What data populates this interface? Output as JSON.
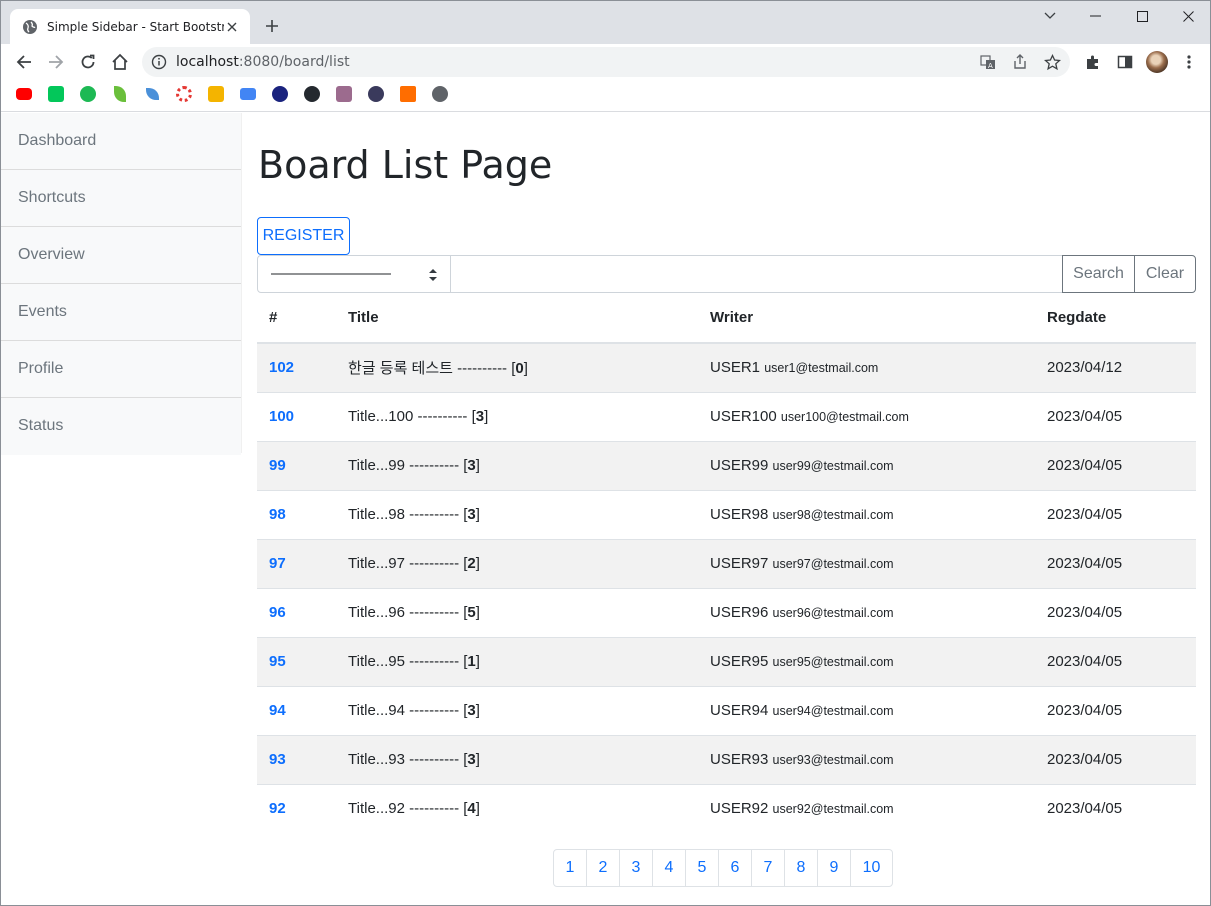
{
  "browser": {
    "tab_title": "Simple Sidebar - Start Bootstrap",
    "url_host": "localhost",
    "url_path": ":8080/board/list",
    "icons": [
      "globe-icon",
      "close-icon",
      "plus-icon",
      "minimize-icon",
      "maximize-icon",
      "window-close-icon",
      "back-icon",
      "forward-icon",
      "reload-icon",
      "home-icon",
      "info-icon",
      "translate-icon",
      "share-icon",
      "star-icon",
      "extensions-icon",
      "sidepanel-icon",
      "menu-icon"
    ],
    "bookmark_colors": [
      "#ff0000",
      "#03c75a",
      "#1db954",
      "#6abf3b",
      "#4a90d9",
      "#e53935",
      "#f4b400",
      "#4285f4",
      "#1a237e",
      "#24292f",
      "#9c6b8e",
      "#3a3a5c",
      "#ff6d00",
      "#5f6368"
    ]
  },
  "sidebar": {
    "items": [
      {
        "label": "Dashboard"
      },
      {
        "label": "Shortcuts"
      },
      {
        "label": "Overview"
      },
      {
        "label": "Events"
      },
      {
        "label": "Profile"
      },
      {
        "label": "Status"
      }
    ]
  },
  "main": {
    "title": "Board List Page",
    "register_label": "REGISTER",
    "search": {
      "select_value": "————————",
      "input_value": "",
      "search_label": "Search",
      "clear_label": "Clear"
    },
    "table": {
      "headers": [
        "#",
        "Title",
        "Writer",
        "Regdate"
      ],
      "rows": [
        {
          "bno": "102",
          "title": "한글 등록 테스트 ---------- [",
          "count": "0",
          "writer": "USER1",
          "email": "user1@testmail.com",
          "regdate": "2023/04/12"
        },
        {
          "bno": "100",
          "title": "Title...100 ---------- [",
          "count": "3",
          "writer": "USER100",
          "email": "user100@testmail.com",
          "regdate": "2023/04/05"
        },
        {
          "bno": "99",
          "title": "Title...99 ---------- [",
          "count": "3",
          "writer": "USER99",
          "email": "user99@testmail.com",
          "regdate": "2023/04/05"
        },
        {
          "bno": "98",
          "title": "Title...98 ---------- [",
          "count": "3",
          "writer": "USER98",
          "email": "user98@testmail.com",
          "regdate": "2023/04/05"
        },
        {
          "bno": "97",
          "title": "Title...97 ---------- [",
          "count": "2",
          "writer": "USER97",
          "email": "user97@testmail.com",
          "regdate": "2023/04/05"
        },
        {
          "bno": "96",
          "title": "Title...96 ---------- [",
          "count": "5",
          "writer": "USER96",
          "email": "user96@testmail.com",
          "regdate": "2023/04/05"
        },
        {
          "bno": "95",
          "title": "Title...95 ---------- [",
          "count": "1",
          "writer": "USER95",
          "email": "user95@testmail.com",
          "regdate": "2023/04/05"
        },
        {
          "bno": "94",
          "title": "Title...94 ---------- [",
          "count": "3",
          "writer": "USER94",
          "email": "user94@testmail.com",
          "regdate": "2023/04/05"
        },
        {
          "bno": "93",
          "title": "Title...93 ---------- [",
          "count": "3",
          "writer": "USER93",
          "email": "user93@testmail.com",
          "regdate": "2023/04/05"
        },
        {
          "bno": "92",
          "title": "Title...92 ---------- [",
          "count": "4",
          "writer": "USER92",
          "email": "user92@testmail.com",
          "regdate": "2023/04/05"
        }
      ]
    },
    "pagination": [
      "1",
      "2",
      "3",
      "4",
      "5",
      "6",
      "7",
      "8",
      "9",
      "10"
    ]
  }
}
